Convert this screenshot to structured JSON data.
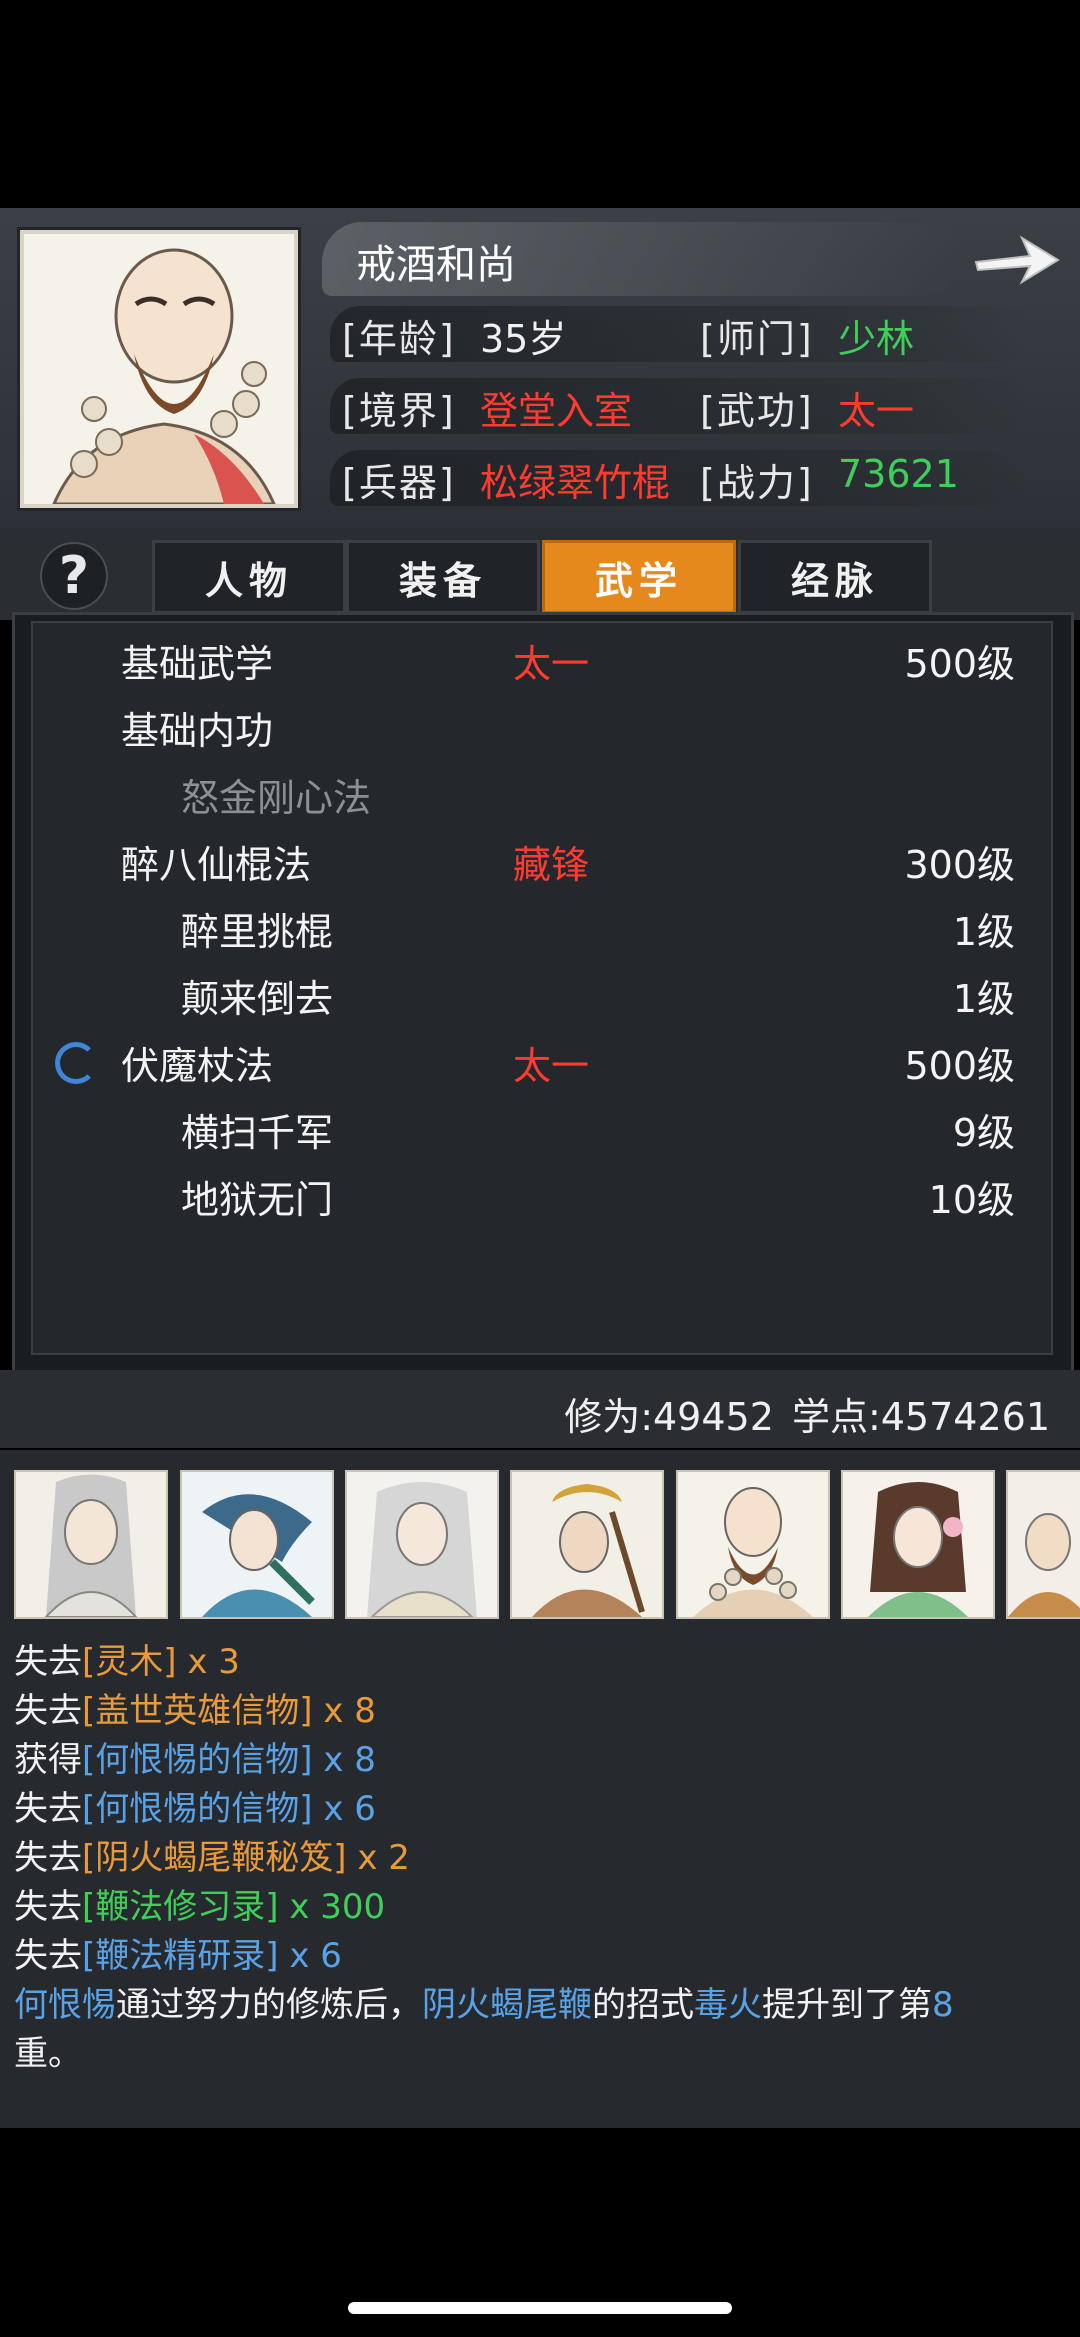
{
  "character": {
    "name": "戒酒和尚",
    "age_label": "[年龄]",
    "age_value": "35岁",
    "sect_label": "[师门]",
    "sect_value": "少林",
    "realm_label": "[境界]",
    "realm_value": "登堂入室",
    "martial_label": "[武功]",
    "martial_value": "太一",
    "weapon_label": "[兵器]",
    "weapon_value": "松绿翠竹棍",
    "power_label": "[战力]",
    "power_value": "73621"
  },
  "help": {
    "label": "?"
  },
  "tabs": [
    {
      "label": "人物",
      "active": false
    },
    {
      "label": "装备",
      "active": false
    },
    {
      "label": "武学",
      "active": true
    },
    {
      "label": "经脉",
      "active": false
    }
  ],
  "skills": [
    {
      "name": "基础武学",
      "grade": "太一",
      "level": "500级",
      "indent": false,
      "dim": false
    },
    {
      "name": "基础内功",
      "grade": "",
      "level": "",
      "indent": false,
      "dim": false
    },
    {
      "name": "怒金刚心法",
      "grade": "",
      "level": "",
      "indent": true,
      "dim": true
    },
    {
      "name": "醉八仙棍法",
      "grade": "藏锋",
      "level": "300级",
      "indent": false,
      "dim": false
    },
    {
      "name": "醉里挑棍",
      "grade": "",
      "level": "1级",
      "indent": true,
      "dim": false
    },
    {
      "name": "颠来倒去",
      "grade": "",
      "level": "1级",
      "indent": true,
      "dim": false
    },
    {
      "name": "伏魔杖法",
      "grade": "太一",
      "level": "500级",
      "indent": false,
      "dim": false
    },
    {
      "name": "横扫千军",
      "grade": "",
      "level": "9级",
      "indent": true,
      "dim": false
    },
    {
      "name": "地狱无门",
      "grade": "",
      "level": "10级",
      "indent": true,
      "dim": false
    }
  ],
  "stats": {
    "text": "修为:49452 学点:4574261"
  },
  "log": {
    "line1_prefix": "失去",
    "line1_item": "[灵木]",
    "line1_count": " x 3",
    "line2_prefix": "失去",
    "line2_item": "[盖世英雄信物]",
    "line2_count": " x 8",
    "line3_prefix": "获得",
    "line3_item": "[何恨惕的信物]",
    "line3_count": " x 8",
    "line4_prefix": "失去",
    "line4_item": "[何恨惕的信物]",
    "line4_count": " x 6",
    "line5_prefix": "失去",
    "line5_item": "[阴火蝎尾鞭秘笈]",
    "line5_count": " x 2",
    "line6_prefix": "失去",
    "line6_item": "[鞭法修习录]",
    "line6_count": " x 300",
    "line7_prefix": "失去",
    "line7_item": "[鞭法精研录]",
    "line7_count": " x 6",
    "line8_part1": "何恨惕",
    "line8_part2": "通过努力的修炼后，",
    "line8_part3": "阴火蝎尾鞭",
    "line8_part4": "的招式",
    "line8_part5": "毒火",
    "line8_part6": "提升到了第",
    "line8_part7": "8",
    "line9_text": "重。"
  },
  "colors": {
    "accent_tab": "#e6891c",
    "grade_red": "#ff3b30",
    "value_green": "#3fcf59",
    "link_blue": "#5aa2e6",
    "item_orange": "#e89a3a"
  }
}
